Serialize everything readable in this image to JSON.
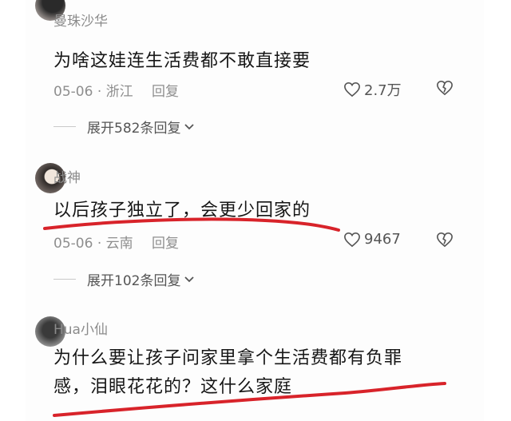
{
  "comments": [
    {
      "username": "曼珠沙华",
      "text": "为啥这娃连生活费都不敢直接要",
      "date": "05-06",
      "location": "浙江",
      "reply": "回复",
      "likes": "2.7万",
      "expand": "展开582条回复"
    },
    {
      "username": "战神",
      "text": "以后孩子独立了，会更少回家的",
      "date": "05-06",
      "location": "云南",
      "reply": "回复",
      "likes": "9467",
      "expand": "展开102条回复"
    },
    {
      "username": "Hua小仙",
      "text_line1": "为什么要让孩子问家里拿个生活费都有负罪",
      "text_line2": "感，泪眼花花的？这什么家庭"
    }
  ],
  "colors": {
    "highlight": "#d8232a",
    "text": "#161616",
    "meta": "#8e8e8e"
  },
  "icons": [
    "heart-icon",
    "broken-heart-icon",
    "chevron-down-icon"
  ]
}
